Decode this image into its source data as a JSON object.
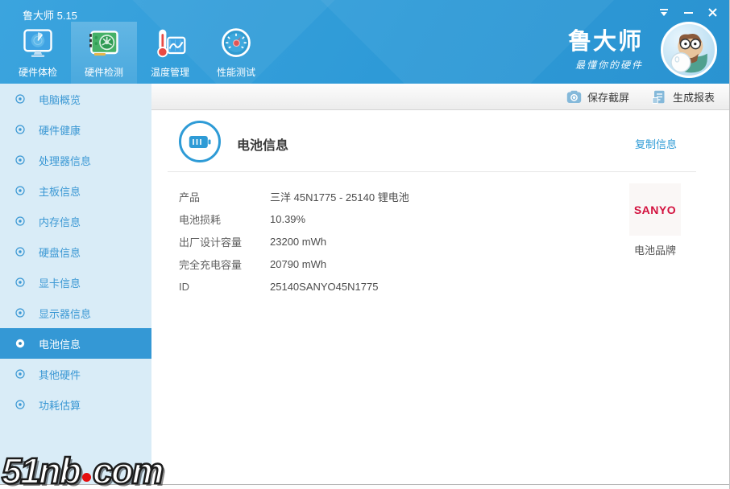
{
  "window": {
    "title": "鲁大师 5.15"
  },
  "header": {
    "tabs": [
      {
        "label": "硬件体检",
        "selected": false
      },
      {
        "label": "硬件检测",
        "selected": true
      },
      {
        "label": "温度管理",
        "selected": false
      },
      {
        "label": "性能测试",
        "selected": false
      }
    ],
    "brand": {
      "name": "鲁大师",
      "tagline": "最懂你的硬件"
    }
  },
  "action_bar": {
    "save_screenshot": "保存截屏",
    "generate_report": "生成报表"
  },
  "sidebar": {
    "items": [
      {
        "label": "电脑概览",
        "selected": false
      },
      {
        "label": "硬件健康",
        "selected": false
      },
      {
        "label": "处理器信息",
        "selected": false
      },
      {
        "label": "主板信息",
        "selected": false
      },
      {
        "label": "内存信息",
        "selected": false
      },
      {
        "label": "硬盘信息",
        "selected": false
      },
      {
        "label": "显卡信息",
        "selected": false
      },
      {
        "label": "显示器信息",
        "selected": false
      },
      {
        "label": "电池信息",
        "selected": true
      },
      {
        "label": "其他硬件",
        "selected": false
      },
      {
        "label": "功耗估算",
        "selected": false
      }
    ]
  },
  "content": {
    "title": "电池信息",
    "copy_link": "复制信息",
    "rows": [
      {
        "label": "产品",
        "value": "三洋 45N1775 - 25140 锂电池"
      },
      {
        "label": "电池损耗",
        "value": "10.39%"
      },
      {
        "label": "出厂设计容量",
        "value": "23200 mWh"
      },
      {
        "label": "完全充电容量",
        "value": "20790 mWh"
      },
      {
        "label": "ID",
        "value": "25140SANYO45N1775"
      }
    ],
    "battery_brand": {
      "logo": "SANYO",
      "caption": "电池品牌"
    }
  },
  "watermark": {
    "prefix": "51nb",
    "suffix": "com"
  },
  "colors": {
    "accent": "#2e9bd6",
    "header_blue": "#2e9ad7",
    "sidebar_bg": "#d9ecf7",
    "selected_item_bg": "#3498d5",
    "sanyo_red": "#d3113e"
  }
}
